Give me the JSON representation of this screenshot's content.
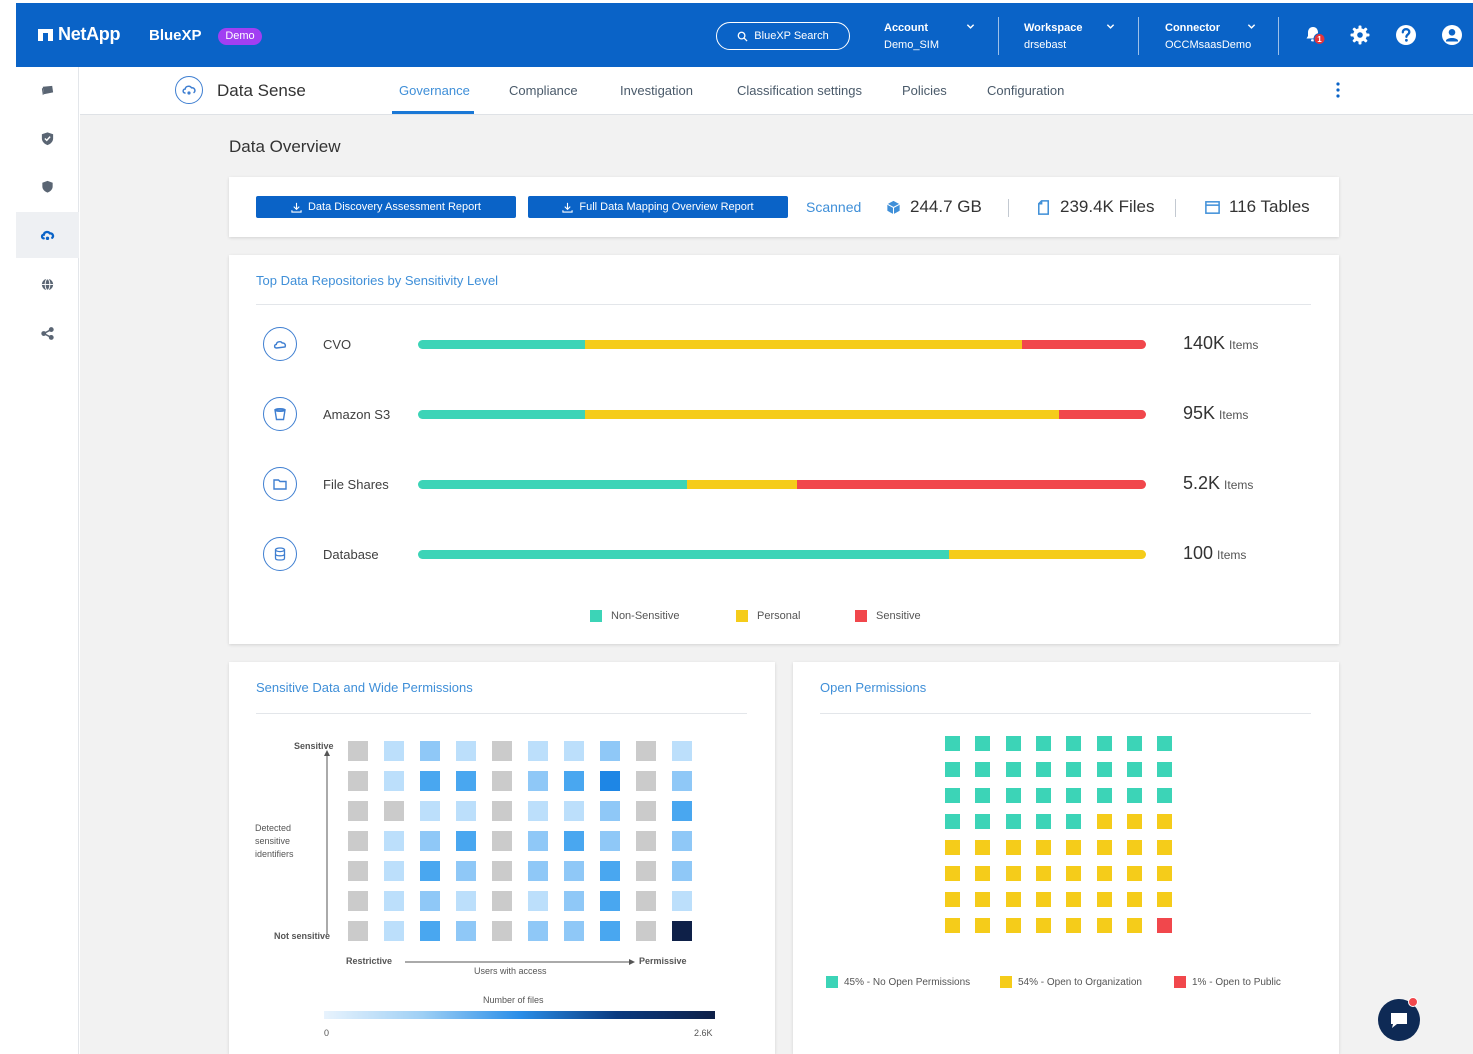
{
  "colors": {
    "brand_blue": "#0a63c7",
    "link_blue": "#3f8fd8",
    "non_sensitive": "#3cd4b7",
    "personal": "#f5cc1a",
    "sensitive": "#f1474c",
    "demo_badge": "#a13ff2"
  },
  "header": {
    "brand": "NetApp",
    "product": "BlueXP",
    "badge": "Demo",
    "search_label": "BlueXP Search",
    "account": {
      "label": "Account",
      "value": "Demo_SIM"
    },
    "workspace": {
      "label": "Workspace",
      "value": "drsebast"
    },
    "connector": {
      "label": "Connector",
      "value": "OCCMsaasDemo"
    },
    "notification_count": "1",
    "icons": [
      "bell-icon",
      "gear-icon",
      "help-icon",
      "user-icon"
    ]
  },
  "rail": {
    "items": [
      "storage-icon",
      "protection-icon",
      "governance-shield-icon",
      "data-sense-icon",
      "globe-icon",
      "share-icon"
    ],
    "active_index": 3
  },
  "subnav": {
    "service": "Data Sense",
    "tabs": [
      "Governance",
      "Compliance",
      "Investigation",
      "Classification settings",
      "Policies",
      "Configuration"
    ],
    "active_tab": "Governance"
  },
  "page": {
    "title": "Data Overview"
  },
  "reports": {
    "discovery_button": "Data Discovery Assessment Report",
    "mapping_button": "Full Data Mapping Overview Report",
    "scanned_label": "Scanned",
    "capacity": "244.7 GB",
    "files": "239.4K Files",
    "tables": "116 Tables"
  },
  "repositories": {
    "title": "Top Data Repositories by Sensitivity Level",
    "items": [
      {
        "name": "CVO",
        "count": "140K",
        "unit": "Items",
        "non_sensitive": 23,
        "personal": 60,
        "sensitive": 17,
        "icon": "cloud-icon"
      },
      {
        "name": "Amazon S3",
        "count": "95K",
        "unit": "Items",
        "non_sensitive": 23,
        "personal": 65,
        "sensitive": 12,
        "icon": "bucket-icon"
      },
      {
        "name": "File Shares",
        "count": "5.2K",
        "unit": "Items",
        "non_sensitive": 37,
        "personal": 15,
        "sensitive": 48,
        "icon": "folder-icon"
      },
      {
        "name": "Database",
        "count": "100",
        "unit": "Items",
        "non_sensitive": 73,
        "personal": 27,
        "sensitive": 0,
        "icon": "database-icon"
      }
    ],
    "legend": [
      "Non-Sensitive",
      "Personal",
      "Sensitive"
    ]
  },
  "permissions_heatmap": {
    "title": "Sensitive Data and Wide Permissions",
    "y_top": "Sensitive",
    "y_bottom": "Not sensitive",
    "y_label": "Detected sensitive identifiers",
    "x_left": "Restrictive",
    "x_right": "Permissive",
    "x_label": "Users with access",
    "scale_label": "Number of files",
    "scale_min": "0",
    "scale_max": "2.6K",
    "grid": [
      [
        -1,
        1,
        2,
        1,
        -1,
        1,
        1,
        2,
        -1,
        1
      ],
      [
        -1,
        1,
        3,
        3,
        -1,
        2,
        3,
        4,
        -1,
        2
      ],
      [
        -1,
        -1,
        1,
        1,
        -1,
        1,
        1,
        2,
        -1,
        3
      ],
      [
        -1,
        1,
        2,
        3,
        -1,
        2,
        3,
        2,
        -1,
        2
      ],
      [
        -1,
        1,
        3,
        2,
        -1,
        2,
        2,
        3,
        -1,
        2
      ],
      [
        -1,
        1,
        2,
        1,
        -1,
        1,
        2,
        3,
        -1,
        1
      ],
      [
        -1,
        1,
        3,
        2,
        -1,
        2,
        2,
        3,
        -1,
        5
      ]
    ]
  },
  "open_permissions": {
    "title": "Open Permissions",
    "columns": 8,
    "rows": 8,
    "cells": [
      "n",
      "n",
      "n",
      "n",
      "n",
      "n",
      "n",
      "n",
      "n",
      "n",
      "n",
      "n",
      "n",
      "n",
      "n",
      "n",
      "n",
      "n",
      "n",
      "n",
      "n",
      "n",
      "n",
      "n",
      "n",
      "n",
      "n",
      "n",
      "n",
      "o",
      "o",
      "o",
      "o",
      "o",
      "o",
      "o",
      "o",
      "o",
      "o",
      "o",
      "o",
      "o",
      "o",
      "o",
      "o",
      "o",
      "o",
      "o",
      "o",
      "o",
      "o",
      "o",
      "o",
      "o",
      "o",
      "o",
      "o",
      "o",
      "o",
      "o",
      "o",
      "o",
      "o",
      "p"
    ],
    "legend": [
      {
        "label": "45% - No Open Permissions",
        "key": "n"
      },
      {
        "label": "54% - Open to Organization",
        "key": "o"
      },
      {
        "label": "1% - Open to Public",
        "key": "p"
      }
    ]
  }
}
